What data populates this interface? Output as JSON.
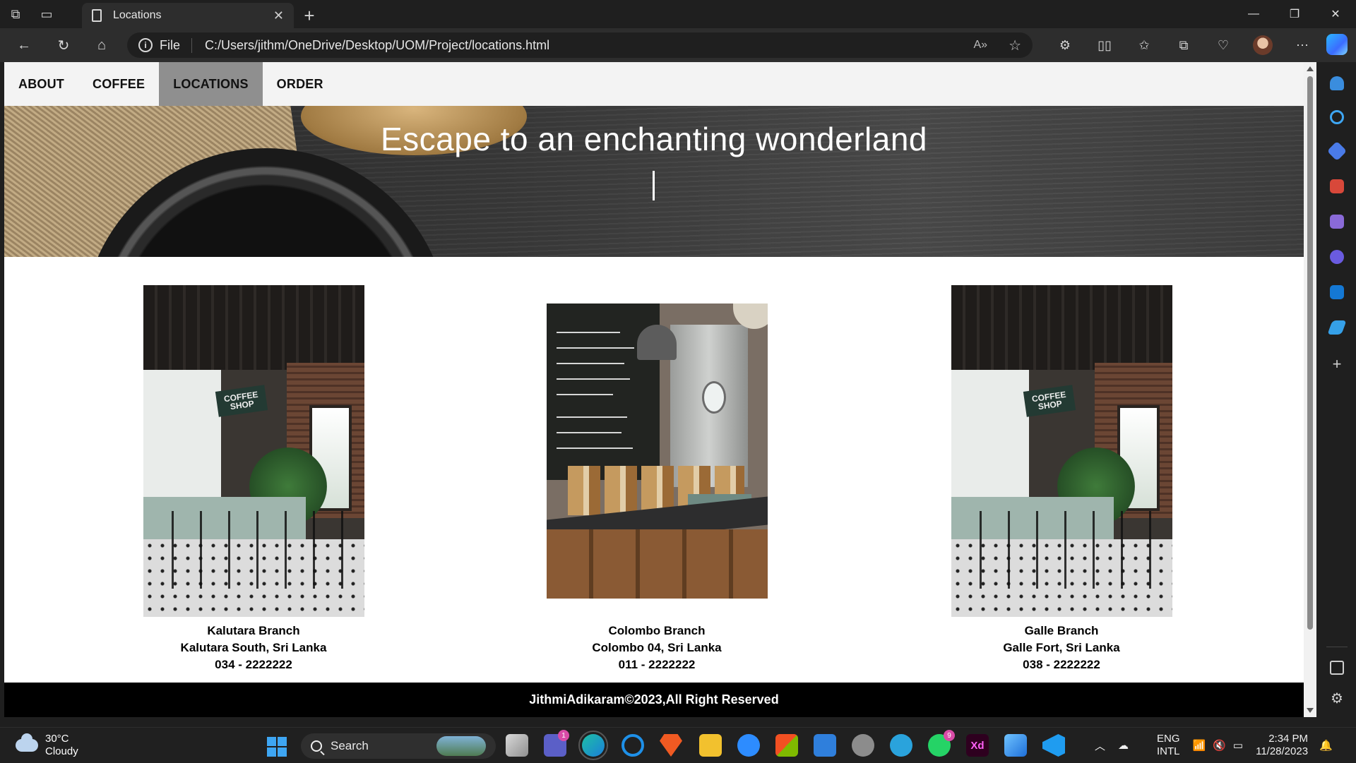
{
  "browser": {
    "tab_title": "Locations",
    "url_scheme": "File",
    "url": "C:/Users/jithm/OneDrive/Desktop/UOM/Project/locations.html"
  },
  "site": {
    "nav": [
      "ABOUT",
      "COFFEE",
      "LOCATIONS",
      "ORDER"
    ],
    "active_nav": "LOCATIONS",
    "hero_title": "Escape to an enchanting wonderland",
    "branches": [
      {
        "name": "Kalutara Branch",
        "address": "Kalutara South, Sri Lanka",
        "phone": "034 - 2222222"
      },
      {
        "name": "Colombo Branch",
        "address": "Colombo 04, Sri Lanka",
        "phone": "011 - 2222222"
      },
      {
        "name": "Galle Branch",
        "address": "Galle Fort, Sri Lanka",
        "phone": "038 - 2222222"
      }
    ],
    "photo_sign_text": "COFFEE SHOP",
    "footer": "JithmiAdikaram©2023,All Right Reserved"
  },
  "taskbar": {
    "weather_temp": "30°C",
    "weather_desc": "Cloudy",
    "search_placeholder": "Search",
    "teams_badge": "1",
    "whatsapp_badge": "9",
    "xd_label": "Xd",
    "lang_top": "ENG",
    "lang_bottom": "INTL",
    "time": "2:34 PM",
    "date": "11/28/2023"
  },
  "colors": {
    "nav_active_bg": "#8f8f8f",
    "nav_bg": "#f3f3f3",
    "footer_bg": "#000000",
    "accent_blue": "#3ea6f3"
  }
}
